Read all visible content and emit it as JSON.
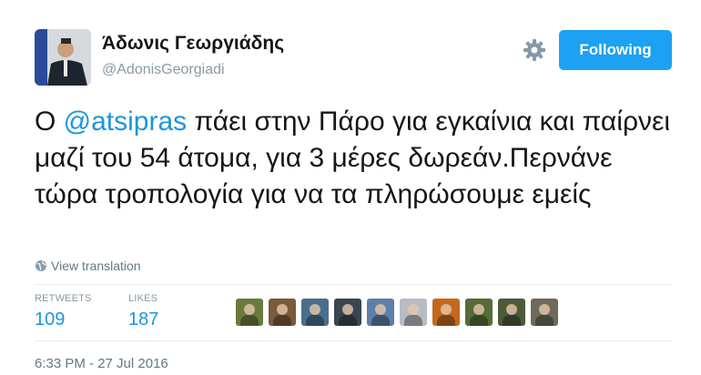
{
  "profile": {
    "display_name": "Άδωνις Γεωργιάδης",
    "username": "@AdonisGeorgiadi",
    "avatar_icon": "profile-photo"
  },
  "actions": {
    "settings_icon": "gear-icon",
    "follow_label": "Following",
    "follow_color": "#1da1f2"
  },
  "tweet": {
    "text_before_mention": "Ο ",
    "mention": "@atsipras",
    "text_after_mention": " πάει στην Πάρο για εγκαίνια και παίρνει μαζί του 54 άτομα, για 3 μέρες δωρεάν.Περνάνε τώρα τροπολογία για να τα πληρώσουμε εμείς",
    "mention_color": "#1b95e0"
  },
  "translation": {
    "label": "View translation",
    "icon": "globe-icon"
  },
  "stats": {
    "retweets_label": "RETWEETS",
    "retweets_value": "109",
    "likes_label": "LIKES",
    "likes_value": "187"
  },
  "likers": [
    {
      "color": "#6b7a3e"
    },
    {
      "color": "#7a5a3a"
    },
    {
      "color": "#4a6f8c"
    },
    {
      "color": "#3b4550"
    },
    {
      "color": "#5d7fa8"
    },
    {
      "color": "#b8bcc2"
    },
    {
      "color": "#c2691f"
    },
    {
      "color": "#556b3a"
    },
    {
      "color": "#4d5a3a"
    },
    {
      "color": "#6f6a5a"
    }
  ],
  "footer": {
    "timestamp": "6:33 PM - 27 Jul 2016"
  }
}
